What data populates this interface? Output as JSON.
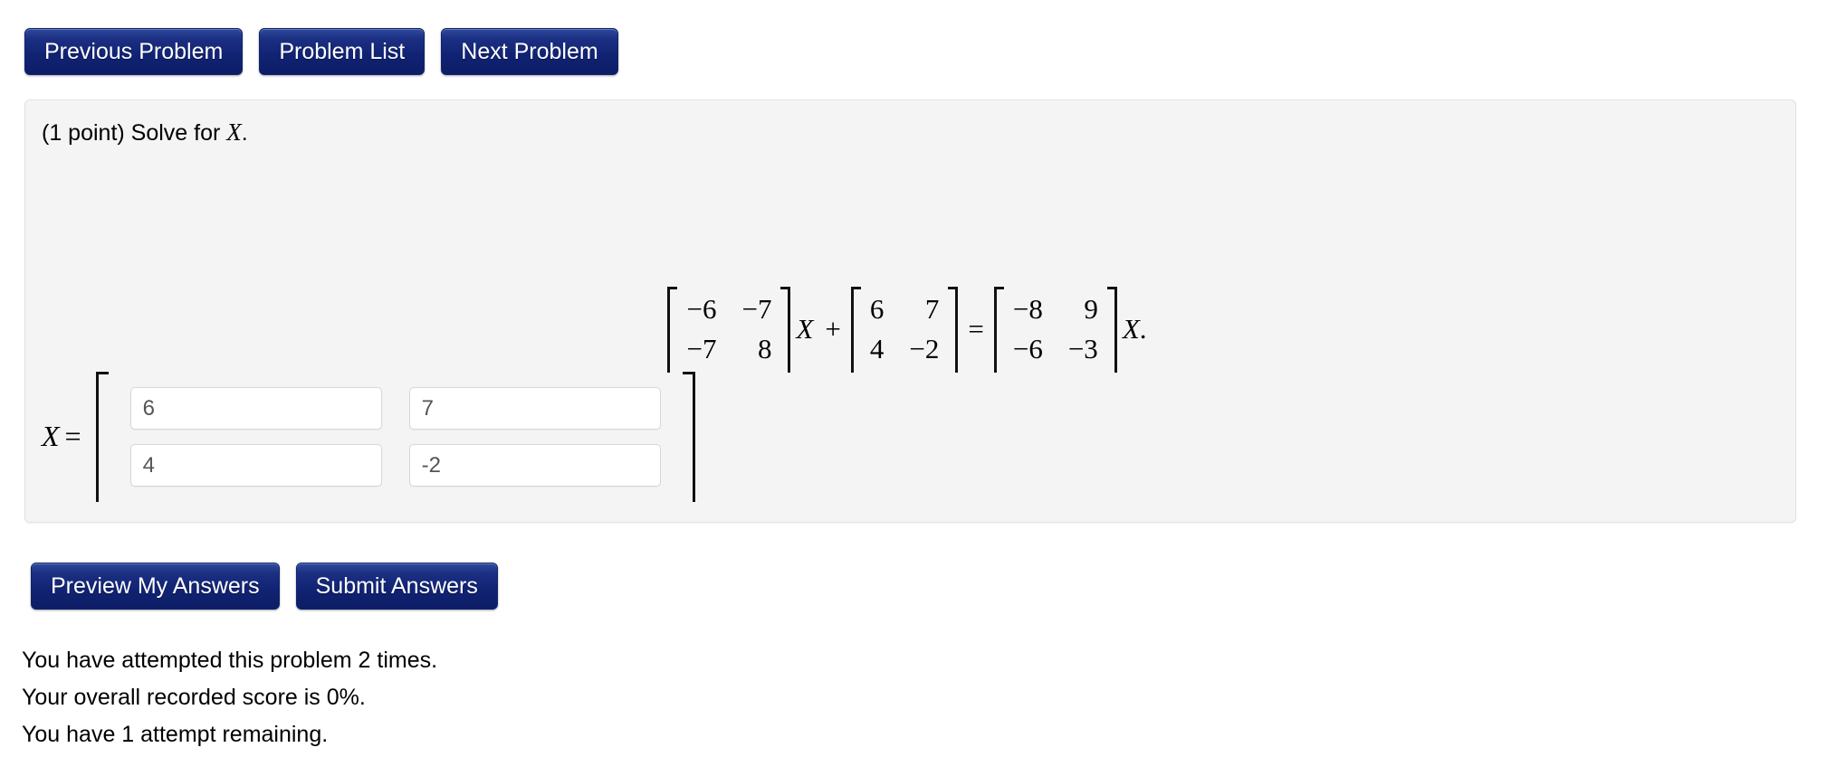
{
  "nav": {
    "buttons": [
      {
        "label": "Previous Problem",
        "name": "previous-problem-button"
      },
      {
        "label": "Problem List",
        "name": "problem-list-button"
      },
      {
        "label": "Next Problem",
        "name": "next-problem-button"
      }
    ]
  },
  "problem": {
    "points_text": "(1 point) Solve for ",
    "variable": "X",
    "period": ".",
    "equation": {
      "matrix_a": {
        "rows": [
          [
            "−6",
            "−7"
          ],
          [
            "−7",
            "8"
          ]
        ]
      },
      "var_after_a": "X",
      "plus": "+",
      "matrix_b": {
        "rows": [
          [
            "6",
            "7"
          ],
          [
            "4",
            "−2"
          ]
        ]
      },
      "equals": "=",
      "matrix_c": {
        "rows": [
          [
            "−8",
            "9"
          ],
          [
            "−6",
            "−3"
          ]
        ]
      },
      "var_after_c": "X",
      "trailing_period": "."
    },
    "answer": {
      "label_var": "X",
      "label_eq": "=",
      "inputs": [
        {
          "name": "answer-input-r1c1",
          "value": "6",
          "placeholder": ""
        },
        {
          "name": "answer-input-r1c2",
          "value": "7",
          "placeholder": ""
        },
        {
          "name": "answer-input-r2c1",
          "value": "4",
          "placeholder": ""
        },
        {
          "name": "answer-input-r2c2",
          "value": "-2",
          "placeholder": ""
        }
      ]
    }
  },
  "actions": {
    "preview_label": "Preview My Answers",
    "submit_label": "Submit Answers"
  },
  "status": {
    "attempts_line": "You have attempted this problem 2 times.",
    "score_line": "Your overall recorded score is 0%.",
    "remaining_line": "You have 1 attempt remaining."
  },
  "colors": {
    "button_navy_top": "#2f4a9c",
    "button_navy_bottom": "#0d1d66",
    "panel_background": "#f4f4f4",
    "panel_border": "#e3e3e3",
    "input_text": "#555555"
  }
}
